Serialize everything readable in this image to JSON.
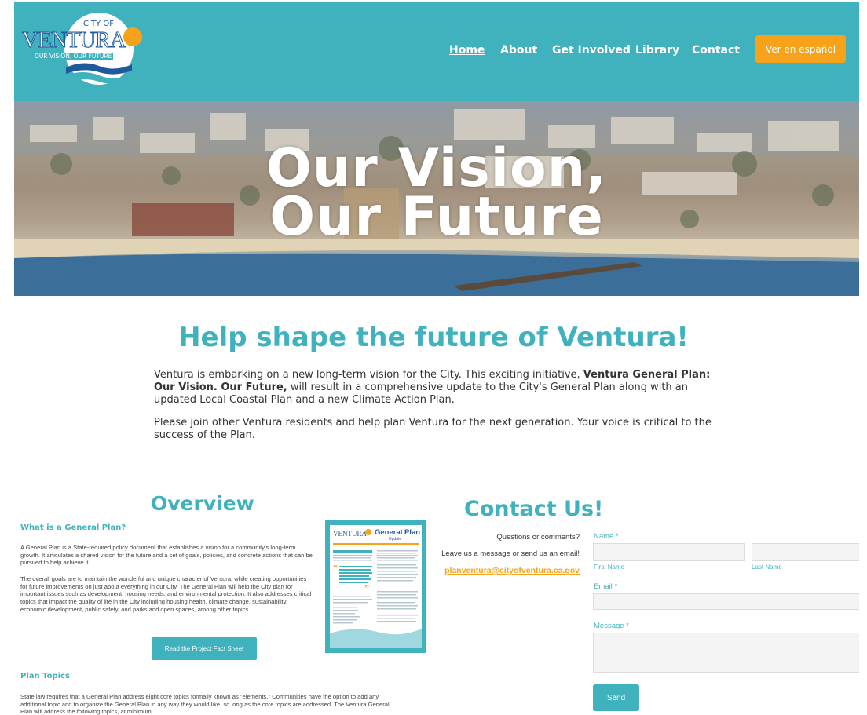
{
  "brand": {
    "logo_top": "CITY OF",
    "logo_main": "VENTURA",
    "logo_tagline": "OUR VISION, OUR FUTURE",
    "teal": "#3fb2bd",
    "orange": "#f7a21b"
  },
  "nav": {
    "items": [
      {
        "label": "Home",
        "active": true
      },
      {
        "label": "About"
      },
      {
        "label": "Get Involved"
      },
      {
        "label": "Library"
      },
      {
        "label": "Contact"
      }
    ],
    "spanish_button": "Ver en español"
  },
  "hero": {
    "line1": "Our Vision,",
    "line2": "Our Future"
  },
  "intro": {
    "title": "Help shape the future of Ventura!",
    "p1_before": "Ventura is embarking on a new long-term vision for the City. This exciting initiative, ",
    "p1_bold": "Ventura General Plan: Our Vision. Our Future,",
    "p1_after": " will result in a comprehensive update to the City's General Plan along with an updated Local Coastal Plan and a new Climate Action Plan.",
    "p2": "Please join other Ventura residents and help plan Ventura for the next generation. Your voice is critical to the success of the Plan."
  },
  "overview": {
    "title": "Overview",
    "what_heading": "What is a General Plan?",
    "p1": "A General Plan is a State-required policy document that establishes a vision for a community's long-term growth. It articulates a shared vision for the future and a set of goals, policies, and concrete actions that can be pursued to help achieve it.",
    "p2": "The overall goals are to maintain the wonderful and unique character of Ventura, while creating opportunities for future improvements on just about everything in our City. The General Plan will help the City plan for important issues such as development, housing needs, and environmental protection. It also addresses critical topics that impact the quality of life in the City including housing health, climate change, sustainability, economic development, public safety, and parks and open spaces, among other topics.",
    "fact_button": "Read the Project Fact Sheet",
    "flyer_title": "General Plan",
    "flyer_subtitle": "Update",
    "topics_heading": "Plan Topics",
    "topics_p": "State law requires that a General Plan address eight core topics formally known as \"elements.\" Communities have the option to add any additional topic and to organize the General Plan in any way they would like, so long as the core topics are addressed. The Ventura General Plan will address the following topics, at minimum."
  },
  "contact": {
    "title": "Contact Us!",
    "line1": "Questions or comments?",
    "line2": "Leave us a message or send us an email!",
    "email": "planventura@cityofventura.ca.gov",
    "name_label": "Name *",
    "first_name": "First Name",
    "last_name": "Last Name",
    "email_label": "Email *",
    "message_label": "Message *",
    "send": "Send"
  }
}
